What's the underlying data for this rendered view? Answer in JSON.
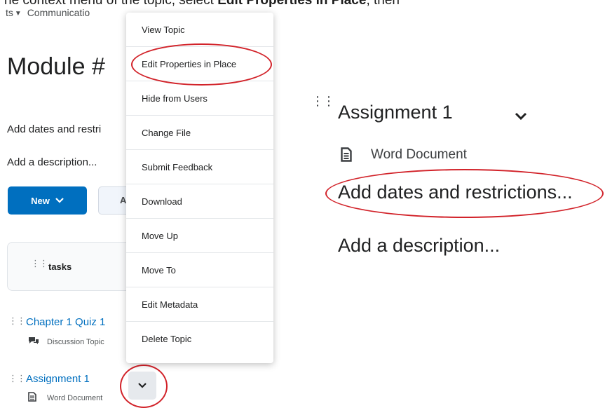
{
  "caption": {
    "text_left": "he context menu of the topic, select ",
    "text_bold": "Edit Properties in Place",
    "text_right": ", then"
  },
  "nav": {
    "item1": "ts",
    "item2": "Communicatio"
  },
  "left": {
    "module_title": "Module #",
    "add_dates": "Add dates and restri",
    "add_description": "Add a description...",
    "new_button": "New",
    "gray_button": "A",
    "tasks_label": "tasks",
    "topics": [
      {
        "title": "Chapter 1 Quiz 1",
        "type": "Discussion Topic"
      },
      {
        "title": "Assignment 1",
        "type": "Word Document"
      }
    ]
  },
  "menu": {
    "items": [
      "View Topic",
      "Edit Properties in Place",
      "Hide from Users",
      "Change File",
      "Submit Feedback",
      "Download",
      "Move Up",
      "Move To",
      "Edit Metadata",
      "Delete Topic"
    ]
  },
  "right": {
    "title": "Assignment 1",
    "doc_type": "Word Document",
    "add_dates": "Add dates and restrictions...",
    "add_description": "Add a description..."
  },
  "colors": {
    "accent": "#006fbf",
    "highlight_ring": "#d2232a"
  }
}
